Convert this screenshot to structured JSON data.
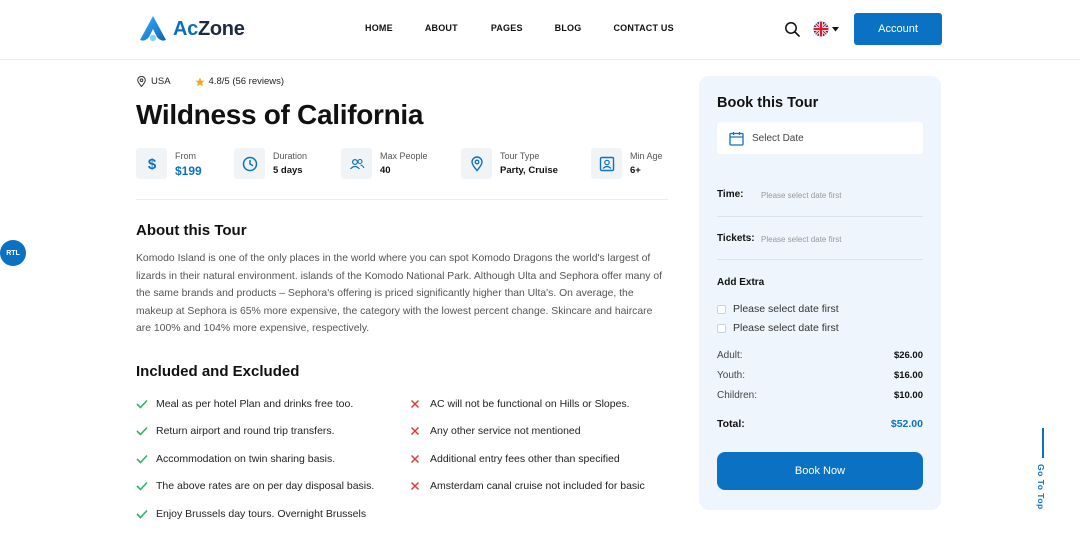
{
  "brand": {
    "name_prefix": "Ac",
    "name_suffix": "Zone",
    "accent": "#0b72c3"
  },
  "nav": {
    "items": [
      "HOME",
      "ABOUT",
      "PAGES",
      "BLOG",
      "CONTACT US"
    ]
  },
  "header": {
    "account_label": "Account",
    "language_flag": "uk-flag-icon"
  },
  "floating": {
    "rtl_label": "RTL",
    "go_top_label": "Go To Top"
  },
  "tour": {
    "location": "USA",
    "rating": "4.8/5 (56 reviews)",
    "title": "Wildness of California",
    "facts": {
      "from": {
        "label": "From",
        "value": "$199"
      },
      "duration": {
        "label": "Duration",
        "value": "5 days"
      },
      "max_people": {
        "label": "Max People",
        "value": "40"
      },
      "tour_type": {
        "label": "Tour Type",
        "value": "Party, Cruise"
      },
      "min_age": {
        "label": "Min Age",
        "value": "6+"
      }
    },
    "about_heading": "About this Tour",
    "about_text": "Komodo Island is one of the only places in the world where you can spot Komodo Dragons the world's largest of lizards in their natural environment. islands of the Komodo National Park. Although Ulta and Sephora offer many of the same brands and products – Sephora's offering is priced significantly higher than Ulta's. On average, the makeup at Sephora is 65% more expensive, the category with the lowest percent change. Skincare and haircare are 100% and 104% more expensive, respectively.",
    "included_heading": "Included and Excluded",
    "included": [
      "Meal as per hotel Plan and drinks free too.",
      "Return airport and round trip transfers.",
      "Accommodation on twin sharing basis.",
      "The above rates are on per day disposal basis.",
      "Enjoy Brussels day tours. Overnight Brussels"
    ],
    "excluded": [
      "AC will not be functional on Hills or Slopes.",
      "Any other service not mentioned",
      "Additional entry fees other than specified",
      "Amsterdam canal cruise not included for basic"
    ]
  },
  "booking": {
    "heading": "Book this Tour",
    "date_placeholder": "Select Date",
    "time_label": "Time:",
    "time_value": "Please select date first",
    "tickets_label": "Tickets:",
    "tickets_value": "Please select date first",
    "add_extra_label": "Add Extra",
    "extras": [
      "Please select date first",
      "Please select date first"
    ],
    "prices": [
      {
        "label": "Adult:",
        "value": "$26.00"
      },
      {
        "label": "Youth:",
        "value": "$16.00"
      },
      {
        "label": "Children:",
        "value": "$10.00"
      }
    ],
    "total_label": "Total:",
    "total_value": "$52.00",
    "book_label": "Book Now"
  }
}
